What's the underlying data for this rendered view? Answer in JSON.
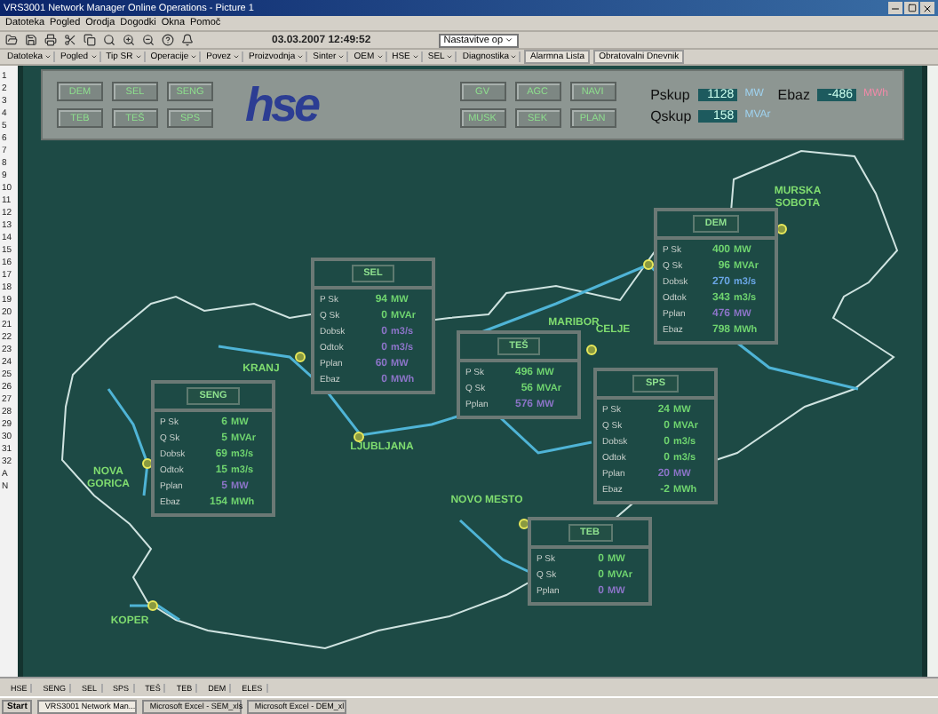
{
  "window": {
    "title": "VRS3001 Network Manager Online Operations - Picture 1"
  },
  "menu": [
    "Datoteka",
    "Pogled",
    "Orodja",
    "Dogodki",
    "Okna",
    "Pomoč"
  ],
  "toolbar": {
    "clock": "03.03.2007 12:49:52",
    "dropdown": "Nastavitve op"
  },
  "nav_menus": [
    "Datoteka",
    "Pogled",
    "Tip SR",
    "Operacije",
    "Povez",
    "Proizvodnja",
    "Sinter",
    "OEM",
    "HSE",
    "SEL",
    "Diagnostika"
  ],
  "nav_links": [
    "Alarmna Lista",
    "Obratovalni Dnevnik"
  ],
  "row_numbers": [
    "1",
    "2",
    "3",
    "4",
    "5",
    "6",
    "7",
    "8",
    "9",
    "10",
    "11",
    "12",
    "13",
    "14",
    "15",
    "16",
    "17",
    "18",
    "19",
    "20",
    "21",
    "22",
    "23",
    "24",
    "25",
    "26",
    "27",
    "28",
    "29",
    "30",
    "31",
    "32",
    "A",
    "N"
  ],
  "header": {
    "left_buttons": [
      "DEM",
      "SEL",
      "SENG",
      "TEB",
      "TEŠ",
      "SPS"
    ],
    "logo": "hse",
    "right_buttons": [
      "GV",
      "AGC",
      "NAVI",
      "MUSK",
      "SEK",
      "PLAN"
    ],
    "readouts": [
      {
        "label": "Pskup",
        "value": "1128",
        "unit": "MW",
        "color": "#9fd3f0"
      },
      {
        "label": "Ebaz",
        "value": "-486",
        "unit": "MWh",
        "color": "#f08aa8"
      },
      {
        "label": "Qskup",
        "value": "158",
        "unit": "MVAr",
        "color": "#9fd3f0"
      }
    ]
  },
  "cities": [
    "MURSKA SOBOTA",
    "MARIBOR",
    "CELJE",
    "KRANJ",
    "LJUBLJANA",
    "NOVA GORICA",
    "NOVO MESTO",
    "KOPER"
  ],
  "plants": [
    {
      "name": "SEL",
      "rows": [
        {
          "label": "P Sk",
          "value": "94",
          "unit": "MW",
          "color": "#6fd46f"
        },
        {
          "label": "Q Sk",
          "value": "0",
          "unit": "MVAr",
          "color": "#6fd46f"
        },
        {
          "label": "Dobsk",
          "value": "0",
          "unit": "m3/s",
          "color": "#8c74c8"
        },
        {
          "label": "Odtok",
          "value": "0",
          "unit": "m3/s",
          "color": "#8c74c8"
        },
        {
          "label": "Pplan",
          "value": "60",
          "unit": "MW",
          "color": "#8c74c8"
        },
        {
          "label": "Ebaz",
          "value": "0",
          "unit": "MWh",
          "color": "#8c74c8"
        }
      ]
    },
    {
      "name": "DEM",
      "rows": [
        {
          "label": "P Sk",
          "value": "400",
          "unit": "MW",
          "color": "#6fd46f"
        },
        {
          "label": "Q Sk",
          "value": "96",
          "unit": "MVAr",
          "color": "#6fd46f"
        },
        {
          "label": "Dobsk",
          "value": "270",
          "unit": "m3/s",
          "color": "#6aa6e6"
        },
        {
          "label": "Odtok",
          "value": "343",
          "unit": "m3/s",
          "color": "#6fd46f"
        },
        {
          "label": "Pplan",
          "value": "476",
          "unit": "MW",
          "color": "#8c74c8"
        },
        {
          "label": "Ebaz",
          "value": "798",
          "unit": "MWh",
          "color": "#6fd46f"
        }
      ]
    },
    {
      "name": "TEŠ",
      "rows": [
        {
          "label": "P Sk",
          "value": "496",
          "unit": "MW",
          "color": "#6fd46f"
        },
        {
          "label": "Q Sk",
          "value": "56",
          "unit": "MVAr",
          "color": "#6fd46f"
        },
        {
          "label": "Pplan",
          "value": "576",
          "unit": "MW",
          "color": "#8c74c8"
        }
      ]
    },
    {
      "name": "SPS",
      "rows": [
        {
          "label": "P Sk",
          "value": "24",
          "unit": "MW",
          "color": "#6fd46f"
        },
        {
          "label": "Q Sk",
          "value": "0",
          "unit": "MVAr",
          "color": "#6fd46f"
        },
        {
          "label": "Dobsk",
          "value": "0",
          "unit": "m3/s",
          "color": "#6fd46f"
        },
        {
          "label": "Odtok",
          "value": "0",
          "unit": "m3/s",
          "color": "#6fd46f"
        },
        {
          "label": "Pplan",
          "value": "20",
          "unit": "MW",
          "color": "#8c74c8"
        },
        {
          "label": "Ebaz",
          "value": "-2",
          "unit": "MWh",
          "color": "#6fd46f"
        }
      ]
    },
    {
      "name": "SENG",
      "rows": [
        {
          "label": "P Sk",
          "value": "6",
          "unit": "MW",
          "color": "#6fd46f"
        },
        {
          "label": "Q Sk",
          "value": "5",
          "unit": "MVAr",
          "color": "#6fd46f"
        },
        {
          "label": "Dobsk",
          "value": "69",
          "unit": "m3/s",
          "color": "#6fd46f"
        },
        {
          "label": "Odtok",
          "value": "15",
          "unit": "m3/s",
          "color": "#6fd46f"
        },
        {
          "label": "Pplan",
          "value": "5",
          "unit": "MW",
          "color": "#8c74c8"
        },
        {
          "label": "Ebaz",
          "value": "154",
          "unit": "MWh",
          "color": "#6fd46f"
        }
      ]
    },
    {
      "name": "TEB",
      "rows": [
        {
          "label": "P Sk",
          "value": "0",
          "unit": "MW",
          "color": "#6fd46f"
        },
        {
          "label": "Q Sk",
          "value": "0",
          "unit": "MVAr",
          "color": "#6fd46f"
        },
        {
          "label": "Pplan",
          "value": "0",
          "unit": "MW",
          "color": "#8c74c8"
        }
      ]
    }
  ],
  "bottom_tabs": [
    "HSE",
    "SENG",
    "SEL",
    "SPS",
    "TEŠ",
    "TEB",
    "DEM",
    "ELES"
  ],
  "taskbar": {
    "start": "Start",
    "tasks": [
      "VRS3001 Network Man...",
      "Microsoft Excel - SEM_xls",
      "Microsoft Excel - DEM_xl"
    ]
  }
}
